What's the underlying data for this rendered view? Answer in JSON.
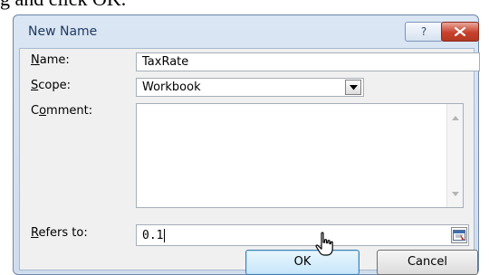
{
  "caption": {
    "text": "g and click OK."
  },
  "dialog": {
    "title": "New Name",
    "help_label": "?",
    "name": {
      "label_pre": "",
      "label_underline": "N",
      "label_post": "ame:",
      "value": "TaxRate"
    },
    "scope": {
      "label_pre": "",
      "label_underline": "S",
      "label_post": "cope:",
      "value": "Workbook"
    },
    "comment": {
      "label_pre": "C",
      "label_underline": "o",
      "label_post": "mment:",
      "value": ""
    },
    "refers_to": {
      "label_pre": "",
      "label_underline": "R",
      "label_post": "efers to:",
      "value": "0.1"
    },
    "ok_label": "OK",
    "cancel_label": "Cancel"
  },
  "icons": {
    "help": "question-icon",
    "close": "close-x-icon",
    "dropdown": "chevron-down-icon",
    "scroll_up": "scroll-up-arrow-icon",
    "scroll_down": "scroll-down-arrow-icon",
    "collapse": "collapse-dialog-icon",
    "cursor": "mouse-pointer-icon"
  },
  "colors": {
    "frame": "#dbe6f4",
    "close_button": "#c8402c",
    "ok_button_highlight": "#c7e6fa"
  }
}
